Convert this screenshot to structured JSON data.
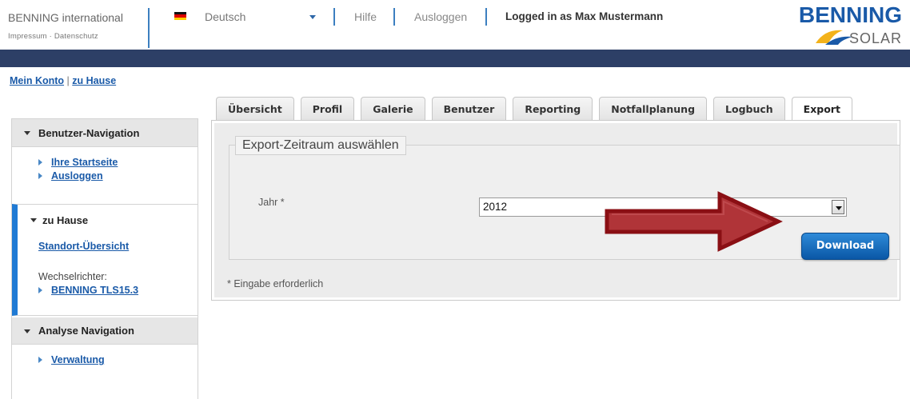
{
  "header": {
    "brand": "BENNING international",
    "impressum": "Impressum",
    "separator": "·",
    "datenschutz": "Datenschutz",
    "language": "Deutsch",
    "help": "Hilfe",
    "logout": "Ausloggen",
    "logged_in": "Logged in as Max Mustermann",
    "logo_text": "BENNING",
    "logo_sub": "SOLAR",
    "accent_color": "#2d3f66",
    "brand_blue": "#1a5aa8"
  },
  "breadcrumb": {
    "item1": "Mein Konto",
    "pipe": "|",
    "item2": "zu Hause"
  },
  "sidebar": {
    "section1_title": "Benutzer-Navigation",
    "section1_items": [
      "Ihre Startseite",
      "Ausloggen"
    ],
    "section2_title": "zu Hause",
    "standort": "Standort-Übersicht",
    "wr_label": "Wechselrichter:",
    "wr_link": "BENNING TLS15.3",
    "section3_title": "Analyse Navigation",
    "section3_items": [
      "Verwaltung"
    ]
  },
  "tabs": [
    "Übersicht",
    "Profil",
    "Galerie",
    "Benutzer",
    "Reporting",
    "Notfallplanung",
    "Logbuch",
    "Export"
  ],
  "active_tab": "Export",
  "export": {
    "legend": "Export-Zeitraum auswählen",
    "year_label": "Jahr *",
    "year_value": "2012",
    "download": "Download",
    "required_note": "* Eingabe erforderlich"
  },
  "icons": {
    "flag": "german-flag-icon",
    "dropdown": "caret-down-icon",
    "annotation": "red-arrow-icon"
  }
}
